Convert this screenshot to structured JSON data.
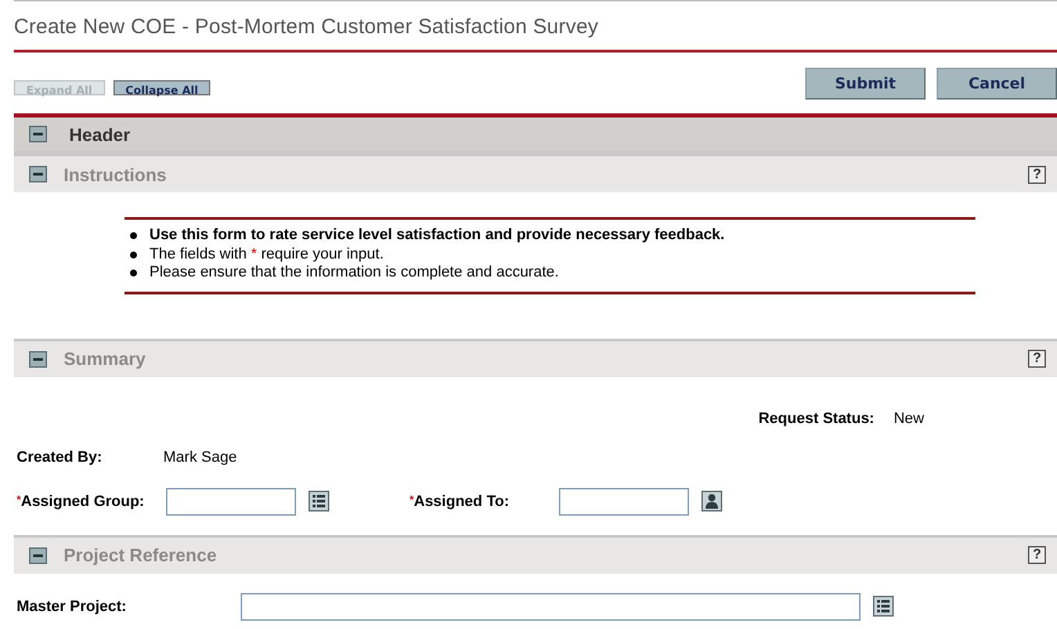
{
  "title": "Create New COE - Post-Mortem Customer Satisfaction Survey",
  "toolbar": [
    {
      "label": "Expand All",
      "disabled": true
    },
    {
      "label": "Collapse All",
      "disabled": false
    }
  ],
  "actions": [
    {
      "label": "Submit"
    },
    {
      "label": "Cancel"
    }
  ],
  "sections": [
    {
      "kind": "header",
      "title": "Header",
      "expanded": true
    },
    {
      "kind": "instructions",
      "title": "Instructions",
      "expanded": true,
      "help": "?",
      "items": [
        {
          "bold": true,
          "before": "Use this form to rate service level satisfaction and provide necessary feedback."
        },
        {
          "bold": false,
          "before": "The fields with",
          "mark": "*",
          "after": "require your input."
        },
        {
          "bold": false,
          "before": "Please ensure that the information is complete and accurate."
        }
      ]
    },
    {
      "kind": "fields",
      "title": "Summary",
      "expanded": true,
      "help": "?",
      "status": {
        "label": "Request Status:",
        "value": "New"
      },
      "rows": [
        [
          {
            "kind": "text",
            "label": "Created By:",
            "value": "Mark Sage"
          }
        ],
        [
          {
            "kind": "list-input",
            "label": "Assigned Group:",
            "mark": "*"
          },
          {
            "kind": "user-input",
            "label": "Assigned To:",
            "mark": "*"
          }
        ]
      ]
    },
    {
      "kind": "fields",
      "title": "Project Reference",
      "expanded": true,
      "help": "?",
      "rows": [
        [
          {
            "kind": "wide-list-input",
            "label": "Master Project:"
          }
        ]
      ]
    }
  ]
}
